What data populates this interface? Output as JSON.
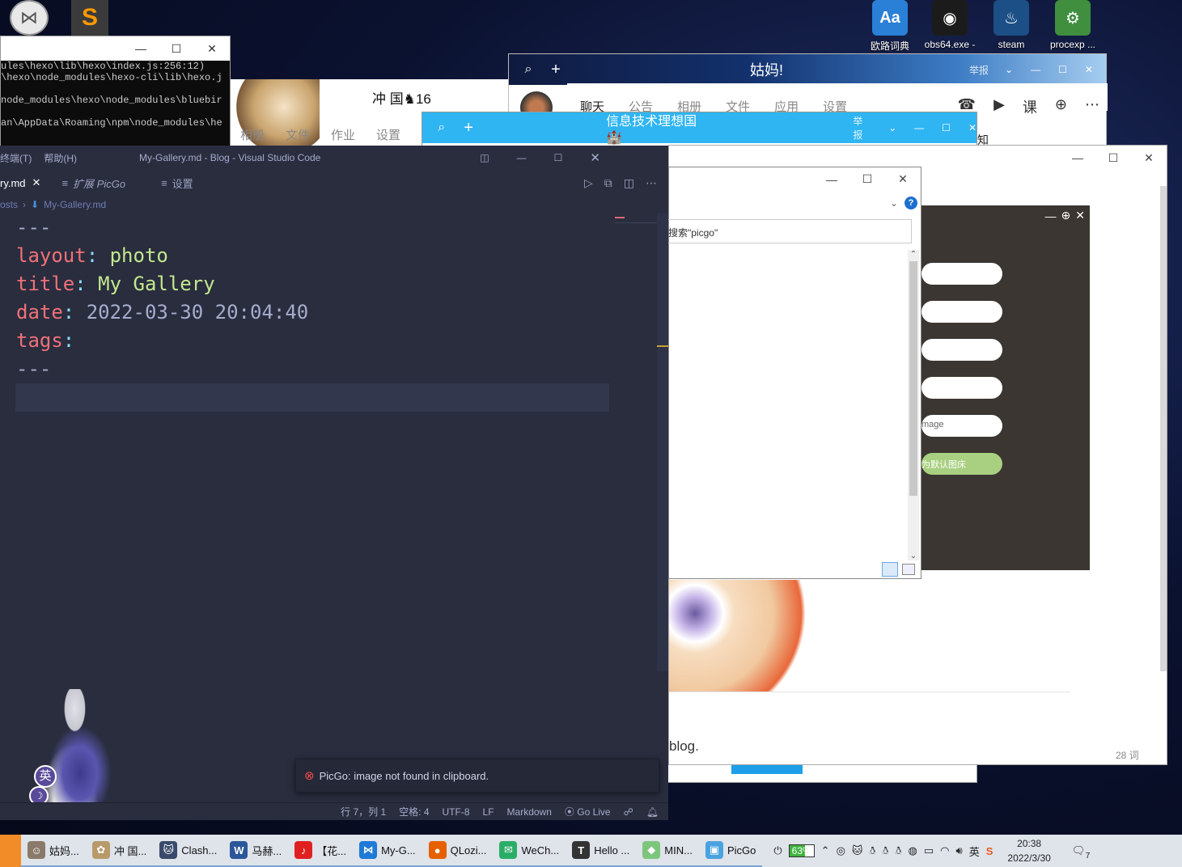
{
  "desktop_icons": [
    {
      "label": "欧路词典",
      "glyph": "Aa",
      "color": "#2a7fd6"
    },
    {
      "label": "obs64.exe -",
      "glyph": "◉",
      "color": "#1b1b1b"
    },
    {
      "label": "steam",
      "glyph": "♨",
      "color": "#1b4f86"
    },
    {
      "label": "procexp ...",
      "glyph": "⚙",
      "color": "#3f8f3f"
    }
  ],
  "terminal": {
    "lines": [
      "ules\\hexo\\lib\\hexo\\index.js:256:12)",
      "\\hexo\\node_modules\\hexo-cli\\lib\\hexo.j",
      "",
      "node_modules\\hexo\\node_modules\\bluebir",
      "",
      "an\\AppData\\Roaming\\npm\\node_modules\\he"
    ]
  },
  "photo_window": {
    "header": "冲 国♞16",
    "tabs": [
      "相册",
      "文件",
      "作业",
      "设置"
    ]
  },
  "qq_chat": {
    "title": "姑妈!",
    "report": "举报",
    "tabs": [
      "聊天",
      "公告",
      "相册",
      "文件",
      "应用",
      "设置"
    ]
  },
  "qq_group": {
    "title": "信息技术理想国🏰",
    "report": "举报",
    "notice_char": "知"
  },
  "file_dialog": {
    "search_placeholder": "搜索\"picgo\""
  },
  "picgo": {
    "image_label": "mage",
    "set_default": "为默认图床"
  },
  "typora": {
    "text_fragment": "blog.",
    "word_count": "28 词"
  },
  "vscode": {
    "title": "My-Gallery.md - Blog - Visual Studio Code",
    "menu": [
      "终端(T)",
      "帮助(H)"
    ],
    "tabs": [
      {
        "label": "ry.md",
        "close": "✕",
        "active": true
      },
      {
        "label": "扩展 PicGo",
        "active": false
      },
      {
        "label": "设置",
        "active": false
      }
    ],
    "breadcrumb": {
      "parent": "osts",
      "file": "My-Gallery.md"
    },
    "code": {
      "sep": "---",
      "layout_key": "layout",
      "layout_val": "photo",
      "title_key": "title",
      "title_val": "My Gallery",
      "date_key": "date",
      "date_val": "2022-03-30 20:04:40",
      "tags_key": "tags"
    },
    "toast": "PicGo: image not found in clipboard.",
    "status": {
      "pos": "行 7，列 1",
      "spaces": "空格: 4",
      "encoding": "UTF-8",
      "eol": "LF",
      "lang": "Markdown",
      "golive": "Go Live"
    },
    "ime": "英"
  },
  "taskbar": {
    "items": [
      {
        "label": "姑妈...",
        "glyph": "☺",
        "color": "#8a7a6a"
      },
      {
        "label": "冲 国...",
        "glyph": "✿",
        "color": "#b89a6a"
      },
      {
        "label": "Clash...",
        "glyph": "🐱",
        "color": "#3a4a6a"
      },
      {
        "label": "马赫...",
        "glyph": "W",
        "color": "#2b579a"
      },
      {
        "label": "【花...",
        "glyph": "♪",
        "color": "#e02020"
      },
      {
        "label": "My-G...",
        "glyph": "⋈",
        "color": "#1e7ad6"
      },
      {
        "label": "QLozi...",
        "glyph": "●",
        "color": "#e66000"
      },
      {
        "label": "WeCh...",
        "glyph": "✉",
        "color": "#2aae67"
      },
      {
        "label": "Hello ...",
        "glyph": "T",
        "color": "#333333"
      },
      {
        "label": "MIN...",
        "glyph": "◆",
        "color": "#7bc67b"
      },
      {
        "label": "PicGo",
        "glyph": "▣",
        "color": "#4aa3df"
      }
    ],
    "battery": "63%",
    "ime": "英",
    "time": "20:38",
    "date": "2022/3/30",
    "notify_count": "7"
  }
}
